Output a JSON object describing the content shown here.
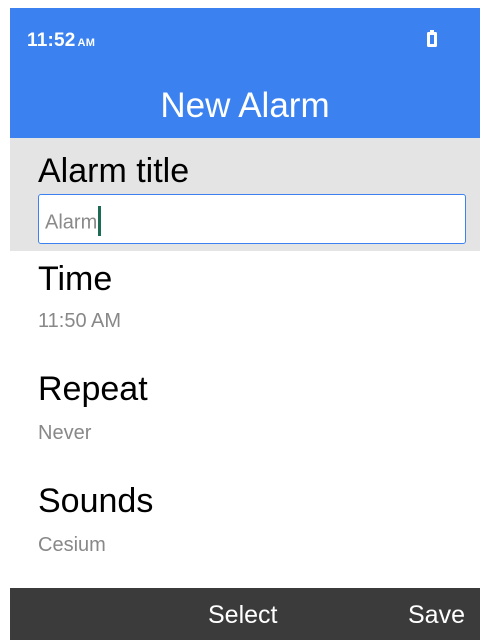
{
  "status_bar": {
    "time": "11:52",
    "ampm": "AM",
    "battery_icon": "battery-icon"
  },
  "header": {
    "title": "New Alarm"
  },
  "fields": {
    "alarm_title": {
      "label": "Alarm title",
      "value": "Alarm"
    },
    "time": {
      "label": "Time",
      "value": "11:50 AM"
    },
    "repeat": {
      "label": "Repeat",
      "value": "Never"
    },
    "sounds": {
      "label": "Sounds",
      "value": "Cesium"
    }
  },
  "softkeys": {
    "center": "Select",
    "right": "Save"
  },
  "colors": {
    "header": "#3b82f0",
    "selected_row": "#e4e4e4",
    "softkey_bar": "#3b3b3b",
    "caret": "#1b6b57"
  }
}
